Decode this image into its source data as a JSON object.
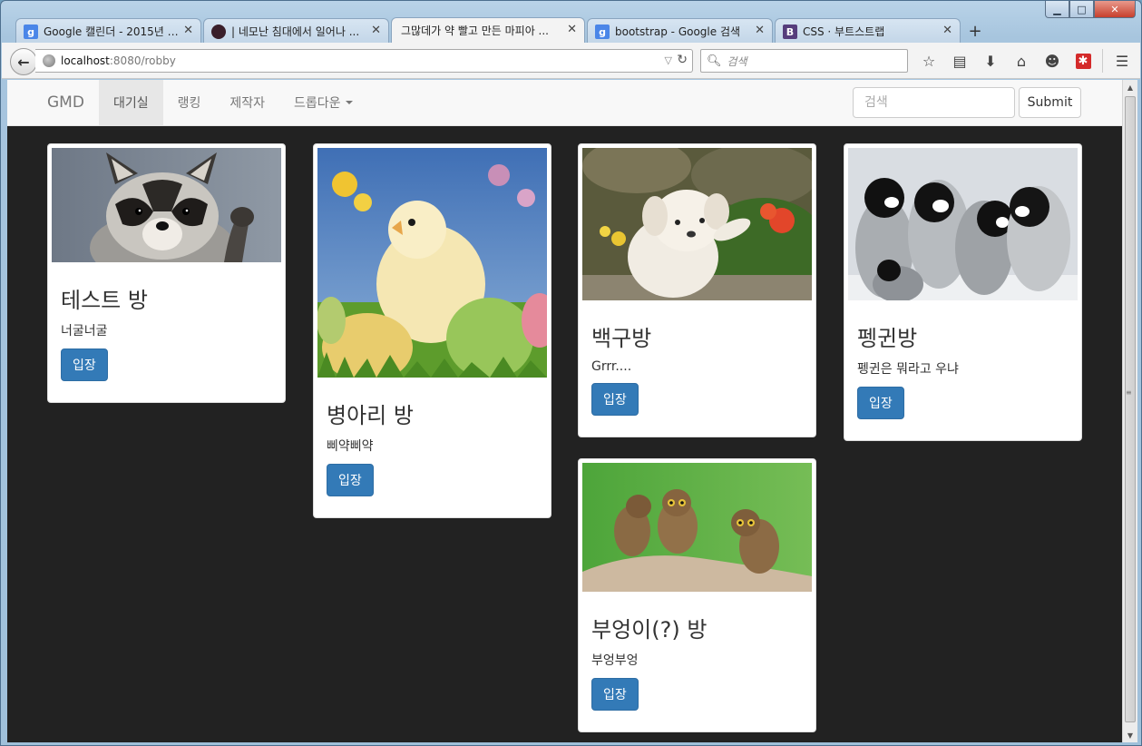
{
  "window": {
    "controls": {
      "minimize": "▁",
      "maximize": "□",
      "close": "✕"
    }
  },
  "tabs": [
    {
      "label": "Google 캘린더 - 2015년 6...",
      "icon": "g",
      "active": false
    },
    {
      "label": "| 네모난 침대에서 일어나 ...",
      "icon": "dark",
      "active": false
    },
    {
      "label": "그많데가 약 빨고 만든 마피아 ...",
      "icon": "",
      "active": true
    },
    {
      "label": "bootstrap - Google 검색",
      "icon": "g",
      "active": false
    },
    {
      "label": "CSS · 부트스트랩",
      "icon": "b",
      "active": false
    }
  ],
  "toolbar": {
    "url_host": "localhost",
    "url_path": ":8080/robby",
    "search_placeholder": "검색"
  },
  "navbar": {
    "brand": "GMD",
    "items": [
      {
        "label": "대기실",
        "active": true
      },
      {
        "label": "랭킹",
        "active": false
      },
      {
        "label": "제작자",
        "active": false
      },
      {
        "label": "드롭다운",
        "active": false,
        "dropdown": true
      }
    ],
    "search_placeholder": "검색",
    "submit_label": "Submit"
  },
  "rooms": [
    {
      "title": "테스트 방",
      "desc": "너굴너굴",
      "button": "입장",
      "image": "raccoon"
    },
    {
      "title": "병아리 방",
      "desc": "삐약삐약",
      "button": "입장",
      "image": "chick"
    },
    {
      "title": "백구방",
      "desc": "Grrr....",
      "button": "입장",
      "image": "puppy"
    },
    {
      "title": "펭귄방",
      "desc": "펭귄은 뭐라고 우냐",
      "button": "입장",
      "image": "penguins"
    },
    {
      "title": "부엉이(?) 방",
      "desc": "부엉부엉",
      "button": "입장",
      "image": "owls"
    }
  ],
  "colors": {
    "page_bg": "#222222",
    "primary_button": "#337ab7",
    "navbar_bg": "#f8f8f8"
  }
}
